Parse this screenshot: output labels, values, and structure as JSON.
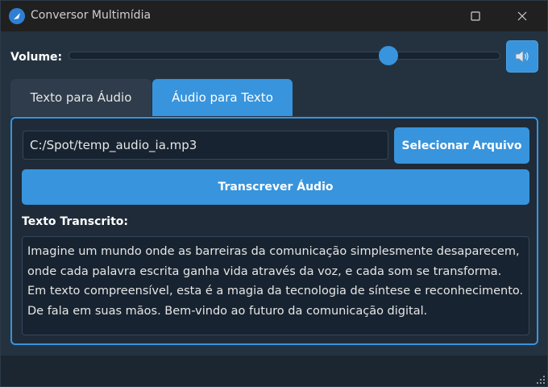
{
  "window": {
    "title": "Conversor Multimídia",
    "icon": "app-icon",
    "controls": [
      "maximize-icon",
      "close-icon"
    ]
  },
  "volume": {
    "label": "Volume:",
    "level": 0.74,
    "speaker_icon": "speaker-icon"
  },
  "tabs": [
    {
      "label": "Texto para Áudio",
      "active": false
    },
    {
      "label": "Áudio para Texto",
      "active": true
    }
  ],
  "audio_to_text": {
    "file_path": "C:/Spot/temp_audio_ia.mp3",
    "select_button": "Selecionar Arquivo",
    "transcribe_button": "Transcrever Áudio",
    "transcript_label": "Texto Transcrito:",
    "transcript_text": "Imagine um mundo onde as barreiras da comunicação simplesmente desaparecem, onde cada palavra escrita ganha vida através da voz, e cada som se transforma. Em texto compreensível, esta é a magia da tecnologia de síntese e reconhecimento. De fala em suas mãos. Bem-vindo ao futuro da comunicação digital."
  },
  "colors": {
    "accent": "#3894dc",
    "background": "#243240",
    "titlebar": "#202020"
  }
}
